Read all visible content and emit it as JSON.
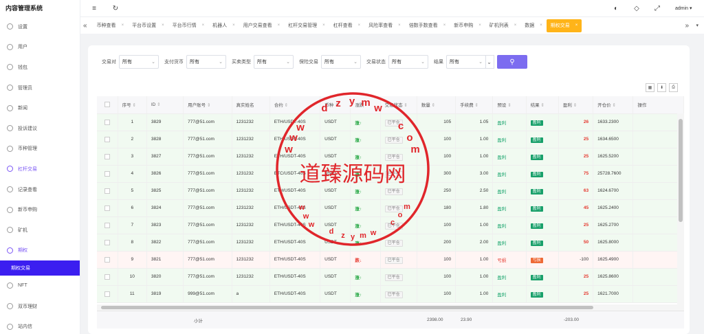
{
  "app": {
    "title": "内容管理系统",
    "user": "admin"
  },
  "sidebar": {
    "items": [
      {
        "label": "设置"
      },
      {
        "label": "用户"
      },
      {
        "label": "钱包"
      },
      {
        "label": "管理员"
      },
      {
        "label": "新闻"
      },
      {
        "label": "投诉建议"
      },
      {
        "label": "币种管理"
      },
      {
        "label": "杠杆交易"
      },
      {
        "label": "记录查看"
      },
      {
        "label": "新币申购"
      },
      {
        "label": "矿机"
      },
      {
        "label": "期权"
      },
      {
        "label": "期权交易"
      },
      {
        "label": "NFT"
      },
      {
        "label": "双币理财"
      },
      {
        "label": "站内信"
      }
    ]
  },
  "tabs": [
    {
      "label": "币种查看"
    },
    {
      "label": "平台币设置"
    },
    {
      "label": "平台币行情"
    },
    {
      "label": "机器人"
    },
    {
      "label": "用户交易查看"
    },
    {
      "label": "杠杆交易管理"
    },
    {
      "label": "杠杆查看"
    },
    {
      "label": "风险率查看"
    },
    {
      "label": "倍数手数查看"
    },
    {
      "label": "新币申购"
    },
    {
      "label": "矿机列表"
    },
    {
      "label": "数据"
    },
    {
      "label": "期权交易"
    }
  ],
  "filters": [
    {
      "label": "交易对",
      "value": "所有"
    },
    {
      "label": "支付货币",
      "value": "所有"
    },
    {
      "label": "买卖类型",
      "value": "所有"
    },
    {
      "label": "保险交易",
      "value": "所有"
    },
    {
      "label": "交易状态",
      "value": "所有"
    },
    {
      "label": "结果",
      "value": "所有"
    }
  ],
  "table": {
    "headers": [
      "序号",
      "ID",
      "用户账号",
      "真实姓名",
      "合约",
      "币种",
      "涨跌",
      "交易状态",
      "数量",
      "手续费",
      "预设",
      "结果",
      "盈利",
      "开仓价",
      "操作"
    ],
    "rows": [
      {
        "n": "1",
        "id": "3829",
        "acct": "777@51.com",
        "name": "1231232",
        "contract": "ETH/USDT-40S",
        "coin": "USDT",
        "dir": "涨↑",
        "status": "已平仓",
        "qty": "105",
        "fee": "1.05",
        "preset": "盈利",
        "result": "盈利",
        "profit": "26",
        "price": "1633.2300",
        "type": "win"
      },
      {
        "n": "2",
        "id": "3828",
        "acct": "777@51.com",
        "name": "1231232",
        "contract": "ETH/USDT-40S",
        "coin": "USDT",
        "dir": "涨↑",
        "status": "已平仓",
        "qty": "100",
        "fee": "1.00",
        "preset": "盈利",
        "result": "盈利",
        "profit": "25",
        "price": "1634.6500",
        "type": "win"
      },
      {
        "n": "3",
        "id": "3827",
        "acct": "777@51.com",
        "name": "1231232",
        "contract": "ETH/USDT-40S",
        "coin": "USDT",
        "dir": "涨↑",
        "status": "已平仓",
        "qty": "100",
        "fee": "1.00",
        "preset": "盈利",
        "result": "盈利",
        "profit": "25",
        "price": "1625.5200",
        "type": "win"
      },
      {
        "n": "4",
        "id": "3826",
        "acct": "777@51.com",
        "name": "1231232",
        "contract": "BTC/USDT-40S",
        "coin": "USDT",
        "dir": "涨↑",
        "status": "已平仓",
        "qty": "300",
        "fee": "3.00",
        "preset": "盈利",
        "result": "盈利",
        "profit": "75",
        "price": "25728.7600",
        "type": "win"
      },
      {
        "n": "5",
        "id": "3825",
        "acct": "777@51.com",
        "name": "1231232",
        "contract": "ETH/USDT-40S",
        "coin": "USDT",
        "dir": "涨↑",
        "status": "已平仓",
        "qty": "250",
        "fee": "2.50",
        "preset": "盈利",
        "result": "盈利",
        "profit": "63",
        "price": "1624.6700",
        "type": "win"
      },
      {
        "n": "6",
        "id": "3824",
        "acct": "777@51.com",
        "name": "1231232",
        "contract": "ETH/USDT-40S",
        "coin": "USDT",
        "dir": "涨↑",
        "status": "已平仓",
        "qty": "180",
        "fee": "1.80",
        "preset": "盈利",
        "result": "盈利",
        "profit": "45",
        "price": "1625.2400",
        "type": "win"
      },
      {
        "n": "7",
        "id": "3823",
        "acct": "777@51.com",
        "name": "1231232",
        "contract": "ETH/USDT-40S",
        "coin": "USDT",
        "dir": "涨↑",
        "status": "已平仓",
        "qty": "100",
        "fee": "1.00",
        "preset": "盈利",
        "result": "盈利",
        "profit": "25",
        "price": "1625.2700",
        "type": "win"
      },
      {
        "n": "8",
        "id": "3822",
        "acct": "777@51.com",
        "name": "1231232",
        "contract": "ETH/USDT-40S",
        "coin": "USDT",
        "dir": "涨↑",
        "status": "已平仓",
        "qty": "200",
        "fee": "2.00",
        "preset": "盈利",
        "result": "盈利",
        "profit": "50",
        "price": "1625.8000",
        "type": "win"
      },
      {
        "n": "9",
        "id": "3821",
        "acct": "777@51.com",
        "name": "1231232",
        "contract": "ETH/USDT-40S",
        "coin": "USDT",
        "dir": "跌↓",
        "status": "已平仓",
        "qty": "100",
        "fee": "1.00",
        "preset": "亏损",
        "result": "亏损",
        "profit": "-100",
        "price": "1625.4900",
        "type": "lose"
      },
      {
        "n": "10",
        "id": "3820",
        "acct": "777@51.com",
        "name": "1231232",
        "contract": "ETH/USDT-40S",
        "coin": "USDT",
        "dir": "涨↑",
        "status": "已平仓",
        "qty": "100",
        "fee": "1.00",
        "preset": "盈利",
        "result": "盈利",
        "profit": "25",
        "price": "1625.8600",
        "type": "win"
      },
      {
        "n": "11",
        "id": "3819",
        "acct": "999@51.com",
        "name": "a",
        "contract": "ETH/USDT-40S",
        "coin": "USDT",
        "dir": "涨↑",
        "status": "已平仓",
        "qty": "100",
        "fee": "1.00",
        "preset": "盈利",
        "result": "盈利",
        "profit": "25",
        "price": "1621.7000",
        "type": "win"
      }
    ],
    "footer": {
      "label": "小计",
      "qty": "2398.00",
      "fee": "23.90",
      "profit": "-203.00"
    }
  },
  "watermark": {
    "text": "道臻源码网"
  },
  "colors": {
    "primary": "#3b1ef0",
    "accent_tab": "#ffb419",
    "search": "#7c6cf0",
    "up": "#1aa23a",
    "down": "#e5352b"
  }
}
